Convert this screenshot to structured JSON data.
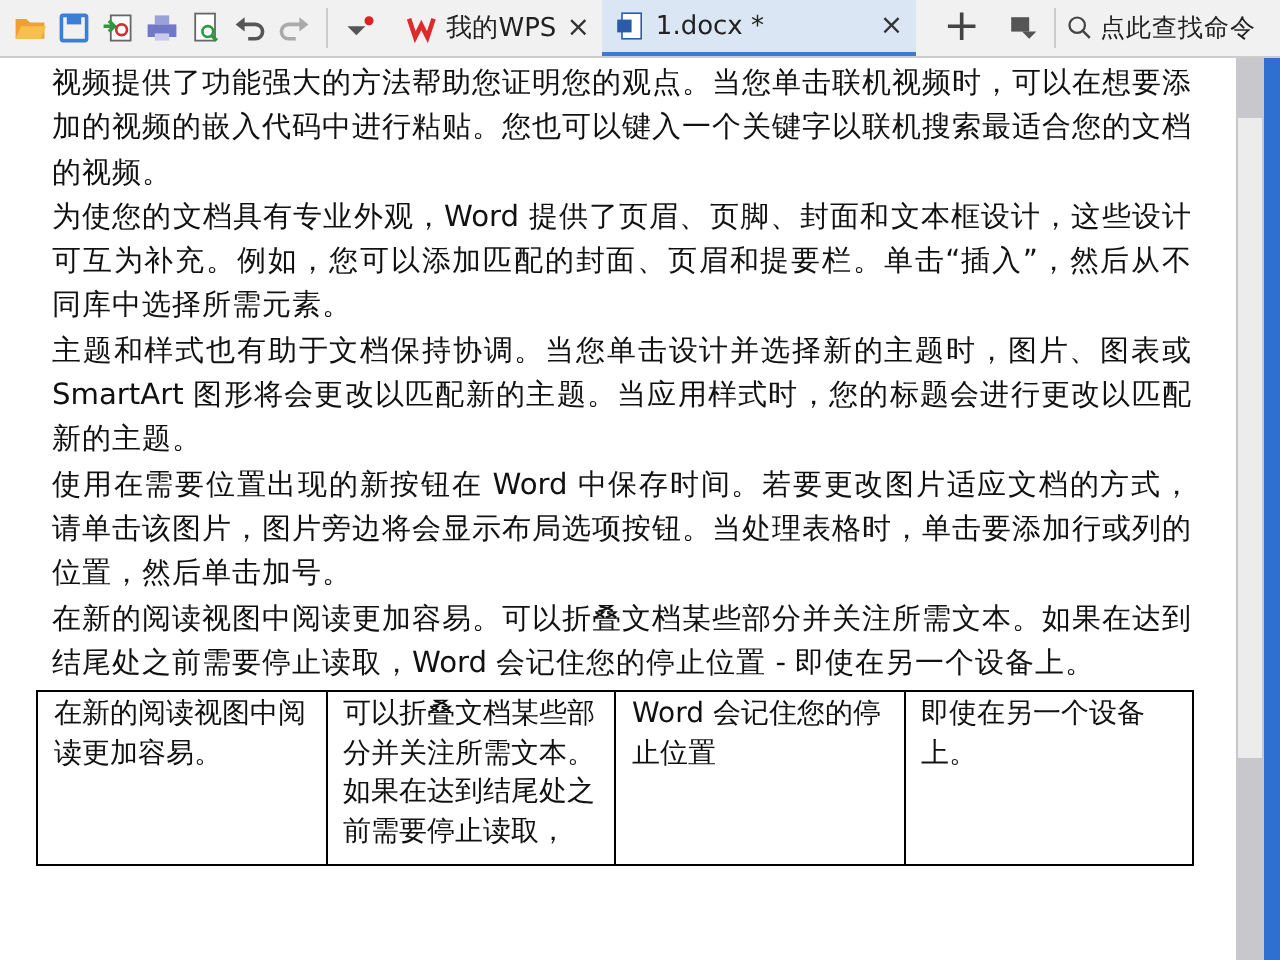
{
  "tabs": [
    {
      "label": "我的WPS",
      "kind": "home",
      "selected": false,
      "close": "×"
    },
    {
      "label": "1.docx *",
      "kind": "doc",
      "selected": true,
      "close": "×"
    }
  ],
  "new_tab": "+",
  "search": {
    "placeholder": "点此查找命令"
  },
  "paragraphs": [
    "视频提供了功能强大的方法帮助您证明您的观点。当您单击联机视频时，可以在想要添加的视频的嵌入代码中进行粘贴。您也可以键入一个关键字以联机搜索最适合您的文档的视频。",
    "为使您的文档具有专业外观，Word 提供了页眉、页脚、封面和文本框设计，这些设计可互为补充。例如，您可以添加匹配的封面、页眉和提要栏。单击“插入”，然后从不同库中选择所需元素。",
    "主题和样式也有助于文档保持协调。当您单击设计并选择新的主题时，图片、图表或 SmartArt 图形将会更改以匹配新的主题。当应用样式时，您的标题会进行更改以匹配新的主题。",
    "使用在需要位置出现的新按钮在 Word 中保存时间。若要更改图片适应文档的方式，请单击该图片，图片旁边将会显示布局选项按钮。当处理表格时，单击要添加行或列的位置，然后单击加号。",
    "在新的阅读视图中阅读更加容易。可以折叠文档某些部分并关注所需文本。如果在达到结尾处之前需要停止读取，Word 会记住您的停止位置 - 即使在另一个设备上。"
  ],
  "table": {
    "rows": [
      [
        "在新的阅读视图中阅读更加容易。",
        "可以折叠文档某些部分并关注所需文本。如果在达到结尾处之前需要停止读取，",
        "Word 会记住您的停止位置",
        "即使在另一个设备上。"
      ]
    ]
  }
}
